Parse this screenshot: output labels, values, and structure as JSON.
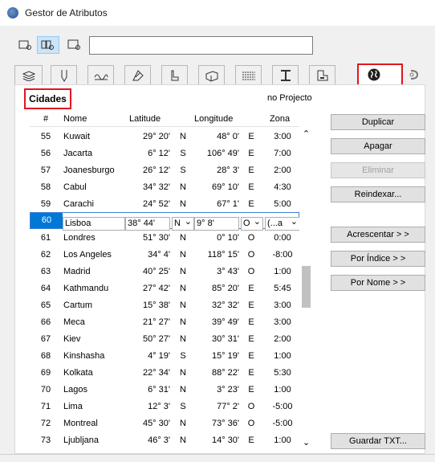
{
  "window": {
    "title": "Gestor de Atributos"
  },
  "section": {
    "title": "Cidades",
    "scope": "no Projecto"
  },
  "columns": [
    "#",
    "Nome",
    "Latitude",
    "Longitude",
    "Zona"
  ],
  "rows": [
    {
      "num": "55",
      "name": "Kuwait",
      "lat": "29° 20'",
      "ns": "N",
      "lon": "48° 0'",
      "ew": "E",
      "tz": "3:00"
    },
    {
      "num": "56",
      "name": "Jacarta",
      "lat": "6° 12'",
      "ns": "S",
      "lon": "106° 49'",
      "ew": "E",
      "tz": "7:00"
    },
    {
      "num": "57",
      "name": "Joanesburgo",
      "lat": "26° 12'",
      "ns": "S",
      "lon": "28° 3'",
      "ew": "E",
      "tz": "2:00"
    },
    {
      "num": "58",
      "name": "Cabul",
      "lat": "34° 32'",
      "ns": "N",
      "lon": "69° 10'",
      "ew": "E",
      "tz": "4:30"
    },
    {
      "num": "59",
      "name": "Carachi",
      "lat": "24° 52'",
      "ns": "N",
      "lon": "67° 1'",
      "ew": "E",
      "tz": "5:00"
    },
    {
      "num": "60",
      "name": "Lisboa",
      "lat": "38° 44'",
      "ns": "N",
      "lon": "9° 8'",
      "ew": "O",
      "tz": "(...a",
      "selected": true
    },
    {
      "num": "61",
      "name": "Londres",
      "lat": "51° 30'",
      "ns": "N",
      "lon": "0° 10'",
      "ew": "O",
      "tz": "0:00"
    },
    {
      "num": "62",
      "name": "Los Angeles",
      "lat": "34° 4'",
      "ns": "N",
      "lon": "118° 15'",
      "ew": "O",
      "tz": "-8:00"
    },
    {
      "num": "63",
      "name": "Madrid",
      "lat": "40° 25'",
      "ns": "N",
      "lon": "3° 43'",
      "ew": "O",
      "tz": "1:00"
    },
    {
      "num": "64",
      "name": "Kathmandu",
      "lat": "27° 42'",
      "ns": "N",
      "lon": "85° 20'",
      "ew": "E",
      "tz": "5:45"
    },
    {
      "num": "65",
      "name": "Cartum",
      "lat": "15° 38'",
      "ns": "N",
      "lon": "32° 32'",
      "ew": "E",
      "tz": "3:00"
    },
    {
      "num": "66",
      "name": "Meca",
      "lat": "21° 27'",
      "ns": "N",
      "lon": "39° 49'",
      "ew": "E",
      "tz": "3:00"
    },
    {
      "num": "67",
      "name": "Kiev",
      "lat": "50° 27'",
      "ns": "N",
      "lon": "30° 31'",
      "ew": "E",
      "tz": "2:00"
    },
    {
      "num": "68",
      "name": "Kinshasha",
      "lat": "4° 19'",
      "ns": "S",
      "lon": "15° 19'",
      "ew": "E",
      "tz": "1:00"
    },
    {
      "num": "69",
      "name": "Kolkata",
      "lat": "22° 34'",
      "ns": "N",
      "lon": "88° 22'",
      "ew": "E",
      "tz": "5:30"
    },
    {
      "num": "70",
      "name": "Lagos",
      "lat": "6° 31'",
      "ns": "N",
      "lon": "3° 23'",
      "ew": "E",
      "tz": "1:00"
    },
    {
      "num": "71",
      "name": "Lima",
      "lat": "12° 3'",
      "ns": "S",
      "lon": "77° 2'",
      "ew": "O",
      "tz": "-5:00"
    },
    {
      "num": "72",
      "name": "Montreal",
      "lat": "45° 30'",
      "ns": "N",
      "lon": "73° 36'",
      "ew": "O",
      "tz": "-5:00"
    },
    {
      "num": "73",
      "name": "Ljubljana",
      "lat": "46° 3'",
      "ns": "N",
      "lon": "14° 30'",
      "ew": "E",
      "tz": "1:00"
    }
  ],
  "buttons": {
    "duplicate": "Duplicar",
    "delete": "Apagar",
    "remove": "Eliminar",
    "reindex": "Reindexar...",
    "add": "Acrescentar > >",
    "by_index": "Por Índice > >",
    "by_name": "Por Nome > >",
    "save_txt": "Guardar TXT..."
  },
  "tabs": [
    "layers-icon",
    "pen-icon",
    "line-type-icon",
    "fill-icon",
    "composite-icon",
    "building-material-icon",
    "surface-icon",
    "profile-icon",
    "zone-icon",
    "city-globe-icon",
    "mep-icon"
  ],
  "colors": {
    "highlight": "#e0161e",
    "selection": "#0078d7"
  }
}
